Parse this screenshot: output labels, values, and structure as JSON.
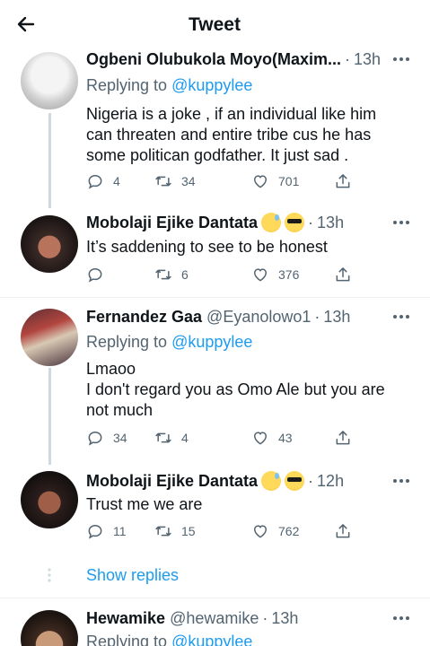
{
  "header": {
    "title": "Tweet",
    "back_icon": "arrow-left-icon"
  },
  "replying_prefix": "Replying to",
  "tweets": [
    {
      "display_name": "Ogbeni Olubukola Moyo(Maxim...",
      "handle": "",
      "time": "13h",
      "replying_to": "@kuppylee",
      "lines": [
        "Nigeria is a joke , if an individual like him",
        "can threaten and entire tribe cus he has",
        "some politican godfather. It just sad ."
      ],
      "replies": "4",
      "retweets": "34",
      "likes": "701"
    },
    {
      "display_name": "Mobolaji Ejike Dantata",
      "emojis": [
        "grinning-sweat-emoji",
        "sunglasses-emoji"
      ],
      "time": "13h",
      "lines": [
        "It’s saddening to see to be honest"
      ],
      "replies": "",
      "retweets": "6",
      "likes": "376"
    },
    {
      "display_name": "Fernandez Gaa",
      "handle": "@Eyanolowo1",
      "time": "13h",
      "replying_to": "@kuppylee",
      "lines": [
        "Lmaoo",
        "I don't regard you as Omo Ale but you are",
        "not much"
      ],
      "replies": "34",
      "retweets": "4",
      "likes": "43"
    },
    {
      "display_name": "Mobolaji Ejike Dantata",
      "emojis": [
        "grinning-sweat-emoji",
        "sunglasses-emoji"
      ],
      "time": "12h",
      "lines": [
        "Trust me we are"
      ],
      "replies": "11",
      "retweets": "15",
      "likes": "762"
    },
    {
      "display_name": "Hewamike",
      "handle": "@hewamike",
      "time": "13h",
      "replying_to": "@kuppylee"
    }
  ],
  "show_replies": "Show replies",
  "colors": {
    "accent": "#1d9bf0",
    "secondary_text": "#536471",
    "thread_line": "#cfd9de"
  }
}
